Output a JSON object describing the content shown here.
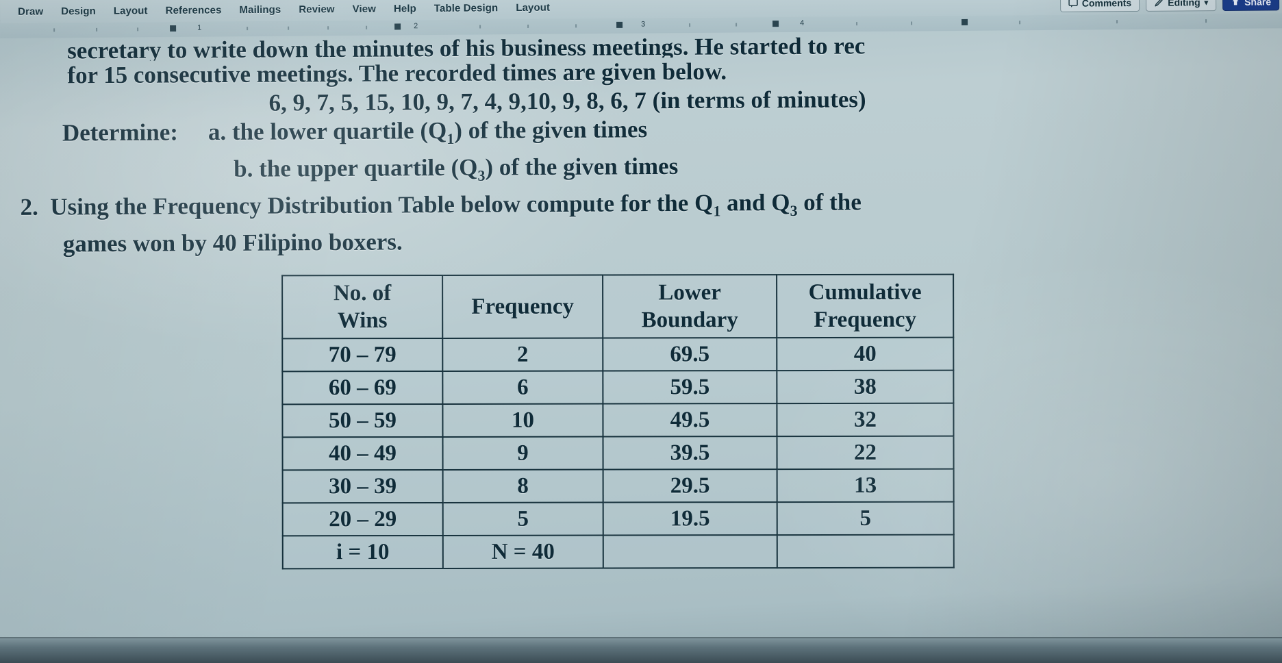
{
  "app": {
    "ribbon_tabs": [
      "Draw",
      "Design",
      "Layout",
      "References",
      "Mailings",
      "Review",
      "View",
      "Help",
      "Table Design",
      "Layout"
    ],
    "comments_label": "Comments",
    "editing_label": "Editing",
    "editing_caret": "▾",
    "share_label": "Share",
    "ruler_numbers": [
      "1",
      "2",
      "3",
      "4"
    ]
  },
  "document": {
    "line1": "secretary to write down the minutes of his business meetings. He started to rec",
    "line2": "for 15 consecutive meetings. The recorded times are given below.",
    "line3": "6, 9, 7, 5, 15, 10, 9, 7, 4, 9,10, 9, 8, 6, 7 (in terms of minutes)",
    "line4_label": "Determine:",
    "line4_item": "a. the lower quartile (Q",
    "line4_sub": "1",
    "line4_tail": ") of the given times",
    "line5_item": "b. the upper quartile (Q",
    "line5_sub": "3",
    "line5_tail": ") of the given times",
    "line6_num": "2.",
    "line6_a": "Using the Frequency Distribution Table below compute for the Q",
    "line6_sub1": "1",
    "line6_b": " and Q",
    "line6_sub2": "3",
    "line6_c": " of the",
    "line7": "games won by 40 Filipino boxers."
  },
  "table": {
    "headers": [
      {
        "l1": "No. of",
        "l2": "Wins"
      },
      {
        "l1": "Frequency",
        "l2": ""
      },
      {
        "l1": "Lower",
        "l2": "Boundary"
      },
      {
        "l1": "Cumulative",
        "l2": "Frequency"
      }
    ],
    "rows": [
      {
        "wins": "70 – 79",
        "frequency": "2",
        "lower_boundary": "69.5",
        "cumulative_frequency": "40"
      },
      {
        "wins": "60 – 69",
        "frequency": "6",
        "lower_boundary": "59.5",
        "cumulative_frequency": "38"
      },
      {
        "wins": "50 – 59",
        "frequency": "10",
        "lower_boundary": "49.5",
        "cumulative_frequency": "32"
      },
      {
        "wins": "40 – 49",
        "frequency": "9",
        "lower_boundary": "39.5",
        "cumulative_frequency": "22"
      },
      {
        "wins": "30 – 39",
        "frequency": "8",
        "lower_boundary": "29.5",
        "cumulative_frequency": "13"
      },
      {
        "wins": "20 – 29",
        "frequency": "5",
        "lower_boundary": "19.5",
        "cumulative_frequency": "5"
      },
      {
        "wins": "i = 10",
        "frequency": "N = 40",
        "lower_boundary": "",
        "cumulative_frequency": ""
      }
    ]
  },
  "colors": {
    "screen_background": "#b7cace",
    "ink": "#0f2b38",
    "share_accent": "#1c3f8f",
    "table_border": "#17323d"
  }
}
